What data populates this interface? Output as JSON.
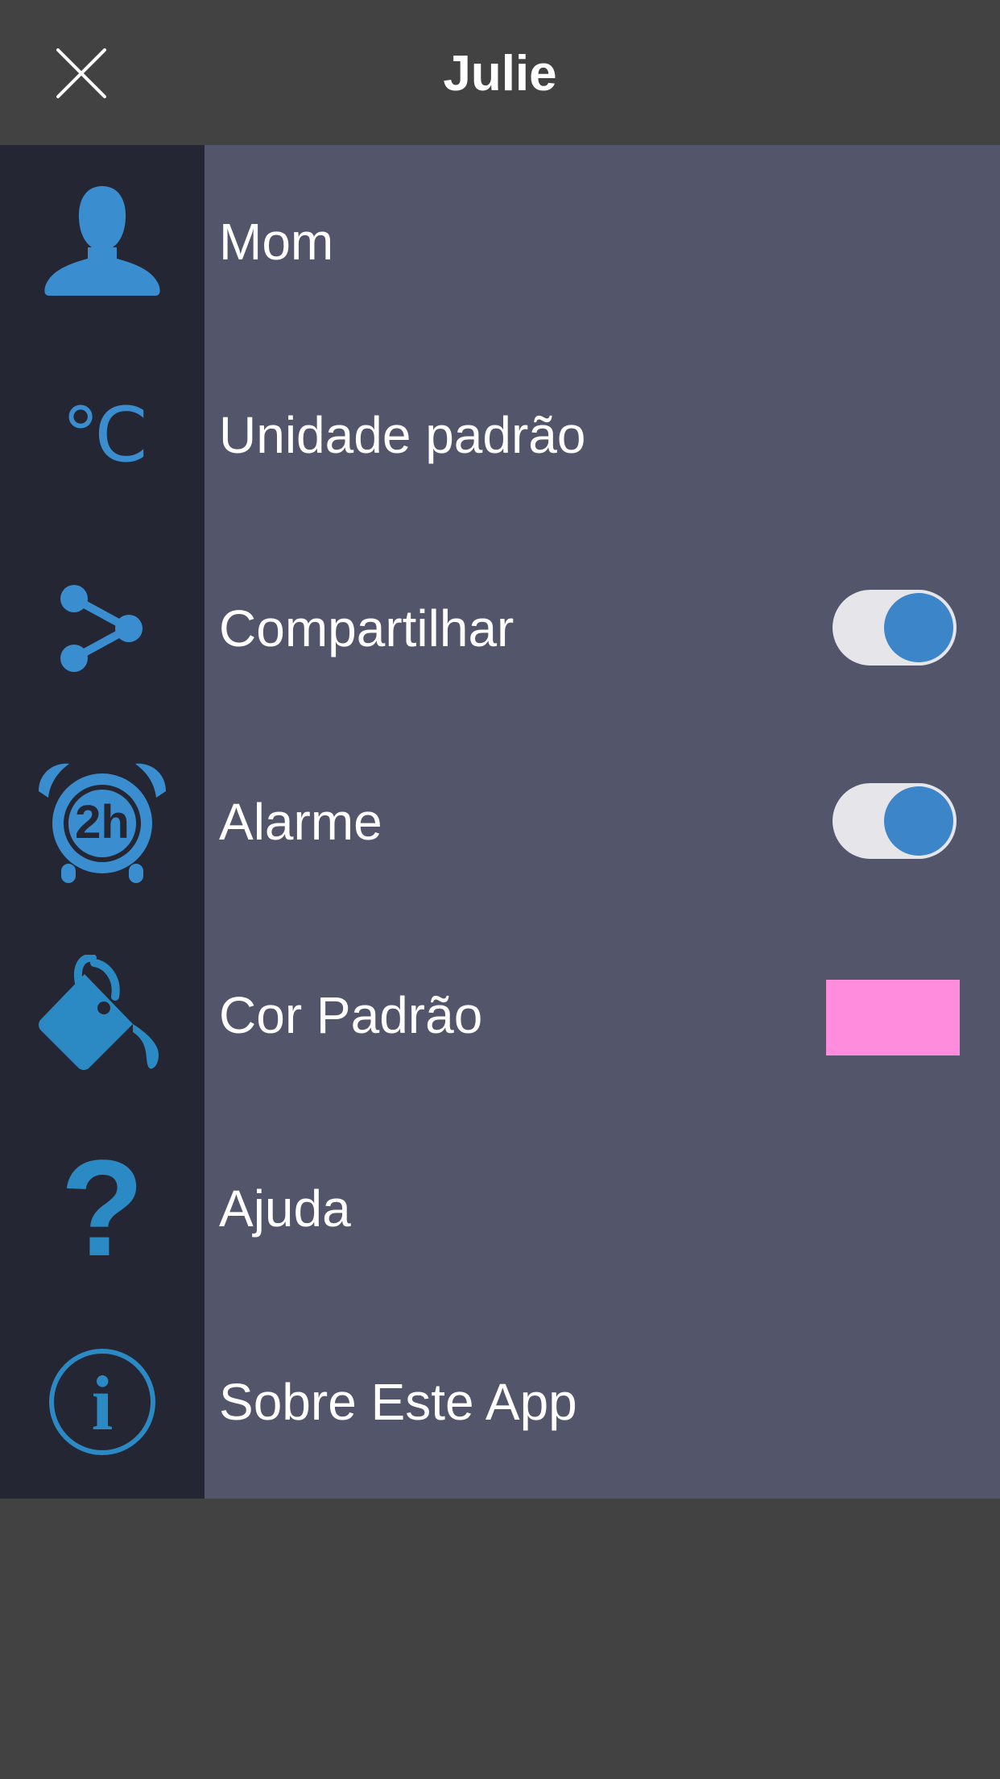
{
  "header": {
    "title": "Julie",
    "close_icon": "close-icon"
  },
  "colors": {
    "header_bg": "#424242",
    "icon_column_bg": "#252633",
    "content_bg": "#53556b",
    "accent": "#3c85c8",
    "default_color_swatch": "#ff8cdc"
  },
  "menu": {
    "items": [
      {
        "label": "Mom",
        "icon": "person-icon"
      },
      {
        "label": "Unidade padrão",
        "icon": "celsius-icon",
        "icon_text": "°C"
      },
      {
        "label": "Compartilhar",
        "icon": "share-icon",
        "toggle_on": true
      },
      {
        "label": "Alarme",
        "icon": "alarm-clock-icon",
        "icon_text": "2h",
        "toggle_on": true
      },
      {
        "label": "Cor Padrão",
        "icon": "paint-bucket-icon",
        "swatch_color": "#ff8cdc"
      },
      {
        "label": "Ajuda",
        "icon": "help-icon",
        "icon_text": "?"
      },
      {
        "label": "Sobre Este App",
        "icon": "info-icon",
        "icon_text": "i"
      }
    ]
  }
}
